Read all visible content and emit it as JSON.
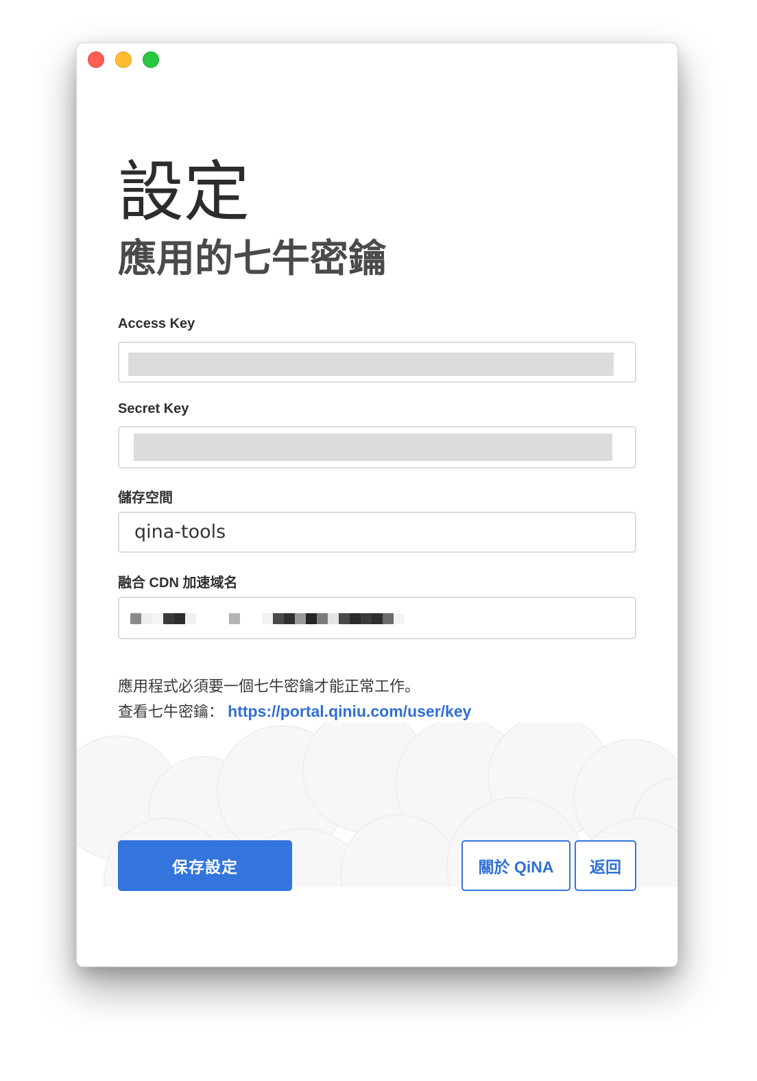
{
  "window": {
    "traffic_lights": [
      "close",
      "minimize",
      "zoom"
    ]
  },
  "header": {
    "title": "設定",
    "subtitle": "應用的七牛密鑰"
  },
  "fields": {
    "access_key": {
      "label": "Access Key",
      "value": ""
    },
    "secret_key": {
      "label": "Secret Key",
      "value": ""
    },
    "bucket": {
      "label": "儲存空間",
      "value": "qina-tools"
    },
    "cdn_domain": {
      "label": "融合 CDN 加速域名",
      "value": ""
    }
  },
  "info": {
    "line1": "應用程式必須要一個七牛密鑰才能正常工作。",
    "line2_prefix": "查看七牛密鑰：",
    "link_text": "https://portal.qiniu.com/user/key"
  },
  "buttons": {
    "save": "保存設定",
    "about": "關於 QiNA",
    "back": "返回"
  },
  "colors": {
    "accent": "#3375dc",
    "link": "#2f6fd6"
  }
}
